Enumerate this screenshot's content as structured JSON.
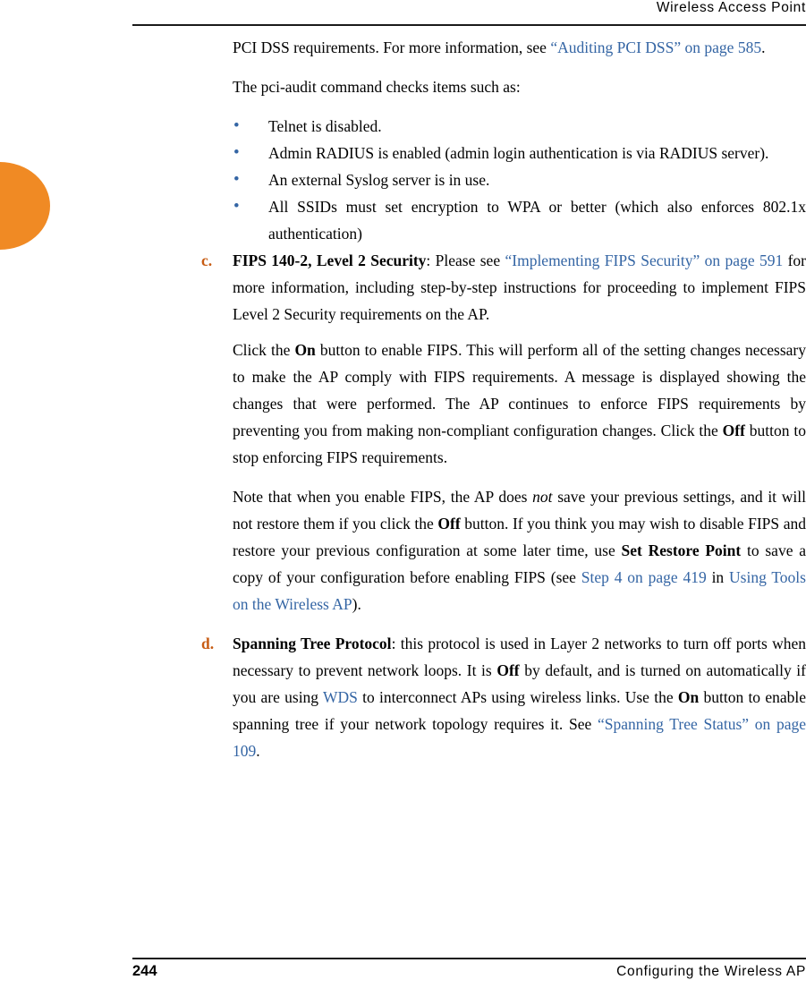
{
  "header": {
    "title": "Wireless Access Point"
  },
  "footer": {
    "page_number": "244",
    "title": "Configuring the Wireless AP"
  },
  "colors": {
    "link": "#3465a4",
    "list_letter": "#c75b12",
    "tab": "#f08a24",
    "rule": "#1a1a1a"
  },
  "paragraphs": {
    "pci_intro_a": "PCI DSS requirements. For more information, see ",
    "pci_intro_link": "“Auditing PCI DSS” on page 585",
    "pci_intro_b": ".",
    "pci_audit_lead": "The pci-audit command checks items such as:",
    "bullets": [
      "Telnet is disabled.",
      "Admin RADIUS is enabled (admin login authentication is via RADIUS server).",
      "An external Syslog server is in use.",
      "All SSIDs must set encryption to WPA or better (which also enforces 802.1x authentication)"
    ]
  },
  "item_c": {
    "letter": "c.",
    "title": "FIPS 140-2, Level 2 Security",
    "t1": ": Please see ",
    "link": "“Implementing FIPS Security” on page 591",
    "t2": " for more information, including step-by-step instructions for proceeding to implement FIPS Level 2 Security requirements on the AP.",
    "p1_a": "Click the ",
    "p1_on": "On",
    "p1_b": " button to enable FIPS. This will perform all of the setting changes necessary to make the AP comply with FIPS requirements. A message is displayed showing the changes that were performed. The AP continues to enforce FIPS requirements by preventing you from making non-compliant configuration changes. Click the ",
    "p1_off": "Off",
    "p1_c": " button to stop enforcing FIPS requirements.",
    "p2_a": "Note that when you enable FIPS, the AP does ",
    "p2_not": "not",
    "p2_b": " save your previous settings, and it will not restore them if you click the ",
    "p2_off": "Off",
    "p2_c": " button. If you think you may wish to disable FIPS and restore your previous configuration at some later time, use ",
    "p2_srp": "Set Restore Point",
    "p2_d": " to save a copy of your configuration before enabling FIPS (see ",
    "p2_link1": "Step 4 on page 419",
    "p2_e": " in ",
    "p2_link2": "Using Tools on the Wireless AP",
    "p2_f": ")."
  },
  "item_d": {
    "letter": "d.",
    "title": "Spanning Tree Protocol",
    "t1": ": this protocol is used in Layer 2 networks to turn off ports when necessary to prevent network loops. It is ",
    "off": "Off",
    "t2": " by default, and is turned on automatically if you are using ",
    "wds": "WDS",
    "t3": " to interconnect APs using wireless links. Use the ",
    "on": "On",
    "t4": " button to enable spanning tree if your network topology requires it. See ",
    "link": "“Spanning Tree Status” on page 109",
    "t5": "."
  }
}
